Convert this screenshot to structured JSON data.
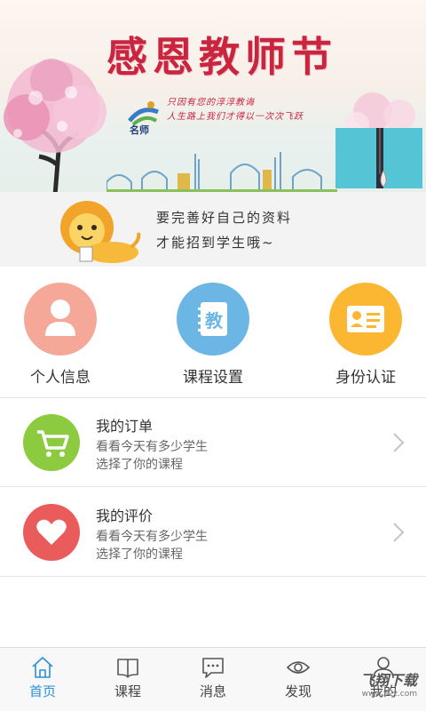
{
  "banner": {
    "title": "感恩教师节",
    "logo_text": "名师",
    "slogan_line1": "只因有您的淳淳教诲",
    "slogan_line2": "人生路上我们才得以一次次飞跃"
  },
  "prompt": {
    "line1": "要完善好自己的资料",
    "line2": "才能招到学生哦~"
  },
  "quick_actions": [
    {
      "label": "个人信息",
      "icon": "person-icon",
      "color": "#f5a898"
    },
    {
      "label": "课程设置",
      "icon": "teach-icon",
      "color": "#6cb6e6",
      "glyph": "教"
    },
    {
      "label": "身份认证",
      "icon": "id-card-icon",
      "color": "#fbb731"
    }
  ],
  "list": [
    {
      "title": "我的订单",
      "sub1": "看看今天有多少学生",
      "sub2": "选择了你的课程",
      "icon": "cart-icon",
      "color": "#8ccb3f"
    },
    {
      "title": "我的评价",
      "sub1": "看看今天有多少学生",
      "sub2": "选择了你的课程",
      "icon": "heart-icon",
      "color": "#ea5c5c"
    }
  ],
  "tabs": [
    {
      "label": "首页",
      "icon": "home-icon",
      "active": true
    },
    {
      "label": "课程",
      "icon": "book-icon",
      "active": false
    },
    {
      "label": "消息",
      "icon": "message-icon",
      "active": false
    },
    {
      "label": "发现",
      "icon": "eye-icon",
      "active": false
    },
    {
      "label": "我的",
      "icon": "user-icon",
      "active": false
    }
  ],
  "watermark": {
    "main": "飞翔下载",
    "sub": "www.52z.com"
  },
  "colors": {
    "accent": "#2c8fd6",
    "banner_title": "#c9253f"
  }
}
